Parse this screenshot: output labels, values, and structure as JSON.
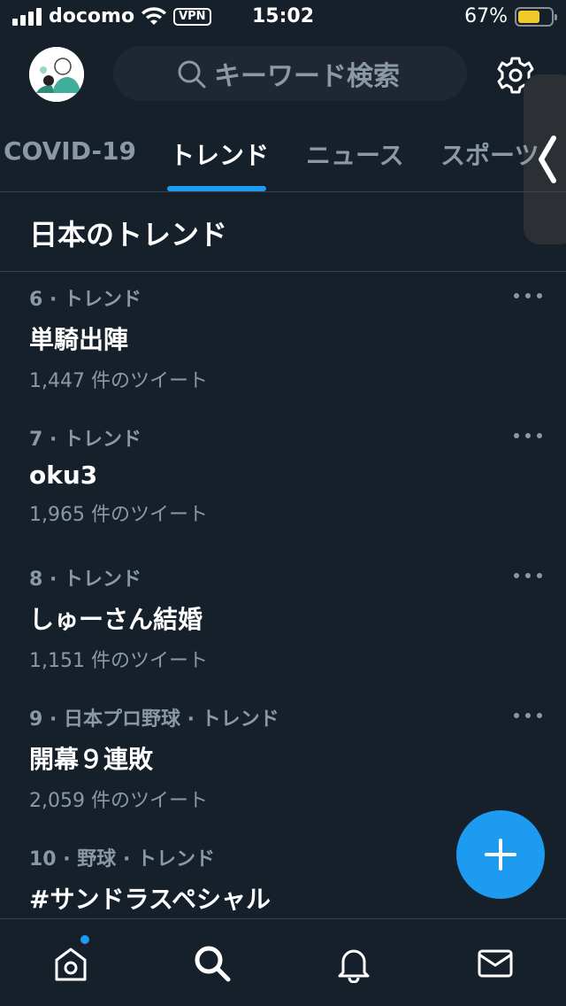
{
  "status_bar": {
    "carrier": "docomo",
    "vpn": "VPN",
    "time": "15:02",
    "battery": "67%",
    "battery_level": 0.67
  },
  "header": {
    "search_placeholder": "キーワード検索"
  },
  "tabs": [
    {
      "label": "COVID-19",
      "active": false
    },
    {
      "label": "トレンド",
      "active": true
    },
    {
      "label": "ニュース",
      "active": false
    },
    {
      "label": "スポーツ",
      "active": false
    }
  ],
  "section_title": "日本のトレンド",
  "trends": [
    {
      "meta": "6 · トレンド",
      "name": "単騎出陣",
      "count": "1,447 件のツイート"
    },
    {
      "meta": "7 · トレンド",
      "name": "oku3",
      "count": "1,965 件のツイート"
    },
    {
      "meta": "8 · トレンド",
      "name": "しゅーさん結婚",
      "count": "1,151 件のツイート"
    },
    {
      "meta": "9 · 日本プロ野球 · トレンド",
      "name": "開幕９連敗",
      "count": "2,059 件のツイート"
    },
    {
      "meta": "10 · 野球 · トレンド",
      "name": "#サンドラスペシャル",
      "count": ""
    }
  ],
  "icons": {
    "avatar": "avatar",
    "search": "search-icon",
    "settings": "gear-icon",
    "handle": "chevron-left-icon",
    "compose": "plus-icon",
    "nav": [
      "home-icon",
      "search-icon",
      "bell-icon",
      "mail-icon"
    ]
  },
  "colors": {
    "background": "#15202b",
    "accent": "#1d9bf0",
    "muted": "#8b98a5"
  }
}
